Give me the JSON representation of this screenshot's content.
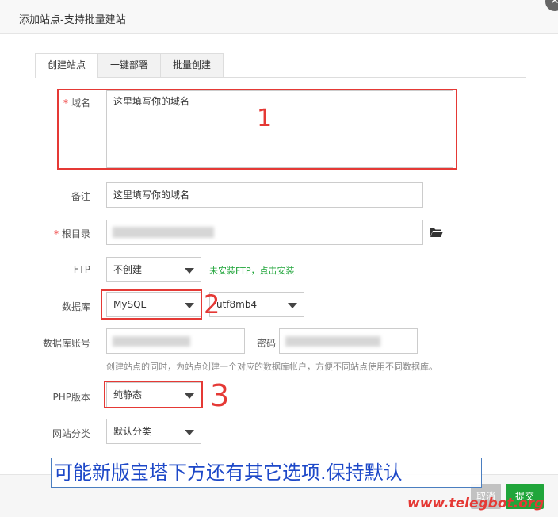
{
  "dialog": {
    "title": "添加站点-支持批量建站",
    "close_glyph": "✕"
  },
  "tabs": [
    {
      "label": "创建站点",
      "active": true
    },
    {
      "label": "一键部署",
      "active": false
    },
    {
      "label": "批量创建",
      "active": false
    }
  ],
  "form": {
    "domain": {
      "label": "域名",
      "required": "*",
      "value": "这里填写你的域名"
    },
    "remark": {
      "label": "备注",
      "value": "这里填写你的域名"
    },
    "root": {
      "label": "根目录",
      "required": "*",
      "value": ""
    },
    "ftp": {
      "label": "FTP",
      "value": "不创建",
      "hint": "未安装FTP，点击安装"
    },
    "database": {
      "label": "数据库",
      "value": "MySQL",
      "charset": "utf8mb4"
    },
    "db_account": {
      "label": "数据库账号",
      "value": "",
      "password_label": "密码",
      "password_value": ""
    },
    "db_hint": "创建站点的同时，为站点创建一个对应的数据库帐户，方便不同站点使用不同数据库。",
    "php": {
      "label": "PHP版本",
      "value": "纯静态"
    },
    "category": {
      "label": "网站分类",
      "value": "默认分类"
    }
  },
  "annotations": {
    "mark1": "1",
    "mark2": "2",
    "mark3": "3",
    "notice": "可能新版宝塔下方还有其它选项.保持默认",
    "watermark": "www.telegbot.org"
  },
  "footer": {
    "cancel_label": "取消",
    "submit_label": "提交"
  },
  "colors": {
    "accent_green": "#20a53a",
    "annotation_red": "#e53935",
    "notice_blue": "#1d48c8"
  },
  "icons": {
    "root_browse": "folder-open-icon"
  }
}
